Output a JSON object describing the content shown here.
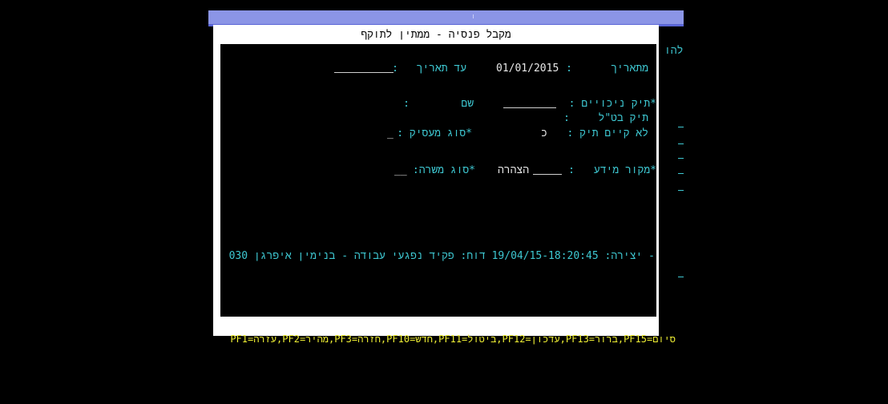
{
  "window": {
    "title": "מקבל פנסיה - ממתין לתוקף"
  },
  "side": {
    "label": "להו"
  },
  "form": {
    "from_date_label": "מתאריך",
    "from_date_sep": ":",
    "from_date_value": "01/01/2015",
    "to_date_label": "עד תאריך",
    "to_date_sep": ":",
    "deductions_label": "*תיק ניכויים :",
    "name_label": "שם",
    "name_sep": ":",
    "nii_label": "תיק בט\"ל",
    "nii_sep": ":",
    "no_file_label": "לא קיים תיק :",
    "no_file_value": "כ",
    "employer_type_label": "*סוג מעסיק :",
    "employer_type_value": "_",
    "source_label": "*מקור מידע",
    "source_sep": ":",
    "source_value": "הצהרה",
    "job_type_label": "*סוג משרה:",
    "job_type_value": "__"
  },
  "status_line": "- יצירה: 19/04/15-18:20:45 דוח: פקיד נפגעי עבודה - בנימין איפרגן 030",
  "pf_keys": "סיום=PF15,ברור=PF13,עדכון=PF12,ביטול=PF11,חדש=PF10,חזרה=PF3,מהיר=PF2,עזרה=PF1",
  "colors": {
    "field_text": "#3ec8d2",
    "pf_text": "#f0f034",
    "topbar": "#8b95e6"
  }
}
